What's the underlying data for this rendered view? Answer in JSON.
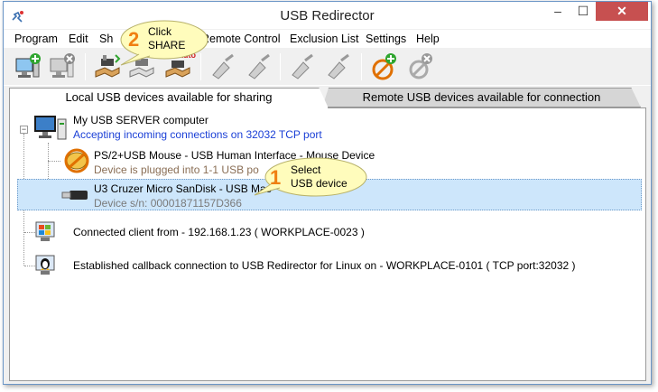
{
  "window": {
    "title": "USB Redirector",
    "minimize": "–",
    "maximize": "☐",
    "close": "✕"
  },
  "menu": [
    "Program",
    "Edit",
    "Share",
    "Remote Control",
    "Exclusion List",
    "Settings",
    "Help"
  ],
  "menu_visible": [
    "Program",
    "Edit",
    "Sh",
    "Remote Control",
    "Exclusion List",
    "Settings",
    "Help"
  ],
  "toolbar": {
    "buttons": [
      "add-server-icon",
      "remove-server-icon",
      "share-icon",
      "unshare-icon",
      "share-auto-icon",
      "connect-icon",
      "disconnect-icon",
      "connect-auto-icon",
      "disconnect-auto-icon",
      "exclude-icon",
      "settings-icon"
    ],
    "auto_label": "auto"
  },
  "tabs": {
    "local": "Local USB devices available for sharing",
    "remote": "Remote USB devices available for connection"
  },
  "tree": {
    "server": {
      "title": "My USB SERVER computer",
      "status": "Accepting incoming connections on 32032 TCP port"
    },
    "mouse": {
      "title": "PS/2+USB Mouse - USB Human Interface - Mouse Device",
      "status": "Device is plugged into 1-1 USB po"
    },
    "flash": {
      "title": "U3 Cruzer Micro SanDisk - USB Mas",
      "status": "Device s/n: 00001871157D366"
    },
    "client": {
      "title": "Connected client from - 192.168.1.23 ( WORKPLACE-0023 )"
    },
    "callback": {
      "title": "Established callback connection to USB Redirector for Linux on - WORKPLACE-0101 ( TCP port:32032 )"
    }
  },
  "callouts": {
    "one": {
      "num": "1",
      "line1": "Select",
      "line2": "USB device"
    },
    "two": {
      "num": "2",
      "line1": "Click",
      "line2": "SHARE"
    }
  },
  "colors": {
    "accent_blue": "#1a3fd6",
    "close_red": "#c75050",
    "callout_fill": "#fffcbc",
    "callout_number": "#f07f12",
    "selection": "#cde6fb"
  }
}
